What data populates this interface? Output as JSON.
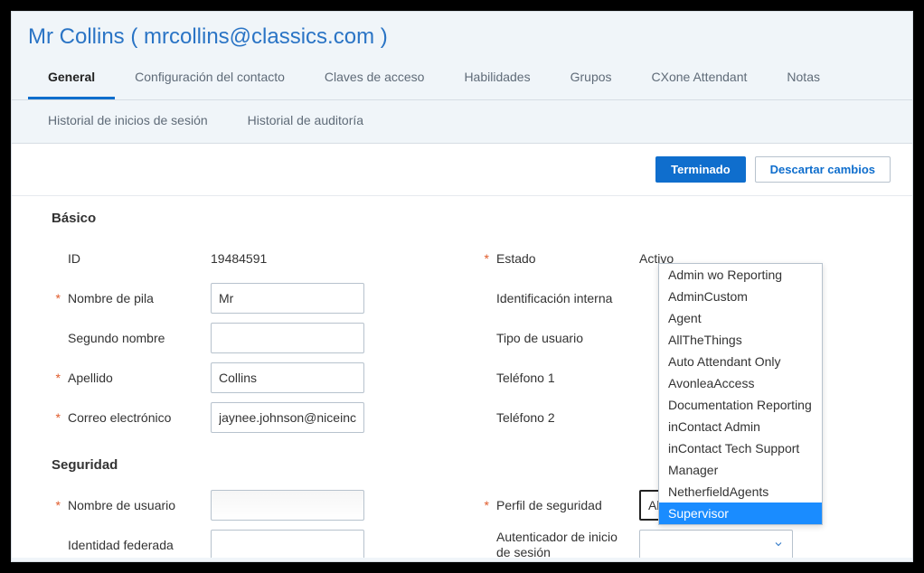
{
  "header": {
    "title": "Mr Collins ( mrcollins@classics.com )"
  },
  "tabs_row1": [
    {
      "label": "General",
      "active": true
    },
    {
      "label": "Configuración del contacto"
    },
    {
      "label": "Claves de acceso"
    },
    {
      "label": "Habilidades"
    },
    {
      "label": "Grupos"
    },
    {
      "label": "CXone Attendant"
    },
    {
      "label": "Notas"
    }
  ],
  "tabs_row2": [
    {
      "label": "Historial de inicios de sesión"
    },
    {
      "label": "Historial de auditoría"
    }
  ],
  "actions": {
    "done": "Terminado",
    "discard": "Descartar cambios"
  },
  "sections": {
    "basic": "Básico",
    "security": "Seguridad"
  },
  "basic": {
    "id_label": "ID",
    "id_value": "19484591",
    "firstname_label": "Nombre de pila",
    "firstname_value": "Mr",
    "middlename_label": "Segundo nombre",
    "middlename_value": "",
    "lastname_label": "Apellido",
    "lastname_value": "Collins",
    "email_label": "Correo electrónico",
    "email_value": "jaynee.johnson@niceinc",
    "state_label": "Estado",
    "state_value": "Activo",
    "internal_id_label": "Identificación interna",
    "usertype_label": "Tipo de usuario",
    "phone1_label": "Teléfono 1",
    "phone2_label": "Teléfono 2"
  },
  "security": {
    "username_label": "Nombre de usuario",
    "federated_label": "Identidad federada",
    "profile_label": "Perfil de seguridad",
    "profile_value": "AllTheThings",
    "authenticator_label": "Autenticador de inicio de sesión"
  },
  "dropdown": {
    "options": [
      "Admin wo Reporting",
      "AdminCustom",
      "Agent",
      "AllTheThings",
      "Auto Attendant Only",
      "AvonleaAccess",
      "Documentation Reporting",
      "inContact Admin",
      "inContact Tech Support",
      "Manager",
      "NetherfieldAgents",
      "Supervisor"
    ],
    "selected": "Supervisor"
  }
}
